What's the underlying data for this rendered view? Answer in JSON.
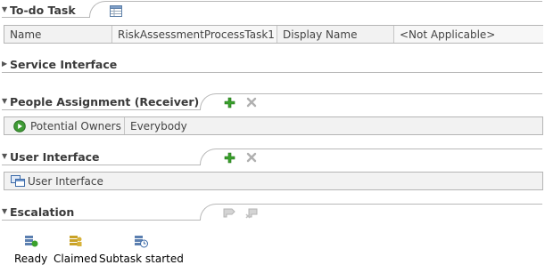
{
  "todo": {
    "title": "To-do Task",
    "fields": [
      {
        "label": "Name",
        "value": "RiskAssessmentProcessTask1"
      },
      {
        "label": "Display Name",
        "value": "<Not Applicable>"
      }
    ]
  },
  "service_interface": {
    "title": "Service Interface"
  },
  "people_assignment": {
    "title": "People Assignment (Receiver)",
    "rows": [
      {
        "role": "Potential Owners",
        "value": "Everybody"
      }
    ]
  },
  "user_interface": {
    "title": "User Interface",
    "rows": [
      {
        "label": "User Interface"
      }
    ]
  },
  "escalation": {
    "title": "Escalation",
    "states": [
      {
        "label": "Ready",
        "icon": "ready-state-icon"
      },
      {
        "label": "Claimed",
        "icon": "claimed-state-icon"
      },
      {
        "label": "Subtask started",
        "icon": "subtask-started-icon"
      }
    ]
  },
  "colors": {
    "add": "#3aa12c",
    "remove": "#b0b0b0",
    "divider": "#b8b8b8",
    "row_bg": "#f2f2f2"
  }
}
